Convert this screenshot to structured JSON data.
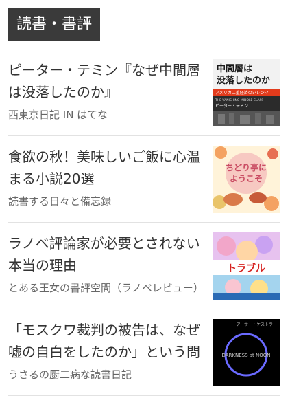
{
  "section": {
    "title": "読書・書評"
  },
  "articles": [
    {
      "title": "ピーター・テミン『なぜ中間層は没落したのか』",
      "source": "西東京日記 IN はてな",
      "thumbnail": {
        "kind": "book-cover",
        "cover_title_line1": "中間層は",
        "cover_title_line2": "没落したのか",
        "cover_subtitle": "アメリカ二重経済のジレンマ",
        "cover_english": "THE VANISHING MIDDLE CLASS",
        "author": "ピーター・テミン",
        "accent_color": "#e23b1c"
      }
    },
    {
      "title": "食欲の秋！美味しいご飯に心温まる小説20選",
      "source": "読書する日々と備忘録",
      "thumbnail": {
        "kind": "book-cover",
        "cover_title_line1": "ちどり亭に",
        "cover_title_line2": "ようこそ",
        "accent_color": "#c94b62"
      }
    },
    {
      "title": "ラノベ評論家が必要とされない本当の理由",
      "source": "とある王女の書評空間（ラノベレビュー）",
      "thumbnail": {
        "kind": "book-cover",
        "cover_title": "トラブル",
        "accent_color": "#d6211f"
      }
    },
    {
      "title": "「モスクワ裁判の被告は、なぜ嘘の自白をしたのか」という問い",
      "source": "うさるの厨二病な読書日記",
      "thumbnail": {
        "kind": "book-cover",
        "cover_title": "DARKNESS at NOON",
        "author": "アーサー・ケストラー",
        "accent_color": "#6a6aff"
      }
    }
  ]
}
